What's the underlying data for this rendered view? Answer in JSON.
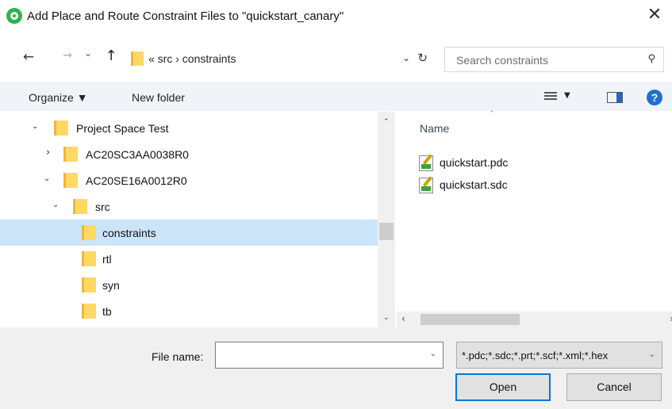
{
  "window": {
    "title": "Add Place and Route Constraint Files to \"quickstart_canary\"",
    "close_glyph": "✕"
  },
  "nav": {
    "back_glyph": "←",
    "forward_glyph": "→",
    "recent_glyph": "⌄",
    "up_glyph": "↑",
    "breadcrumb": "«  src  ›  constraints",
    "refresh_glyph": "↻",
    "address_dropdown_glyph": "⌄",
    "search_placeholder": "Search constraints",
    "search_glyph": "⚲"
  },
  "toolbar": {
    "organize_label": "Organize ▼",
    "new_folder_label": "New folder",
    "view_dropdown_glyph": "▼",
    "help_glyph": "?"
  },
  "tree": {
    "items": [
      {
        "label": "Project Space Test",
        "chevron": "⌄",
        "level": 0,
        "expanded": true,
        "selected": false
      },
      {
        "label": "AC20SC3AA0038R0",
        "chevron": "›",
        "level": 1,
        "expanded": false,
        "selected": false
      },
      {
        "label": "AC20SE16A0012R0",
        "chevron": "⌄",
        "level": 1,
        "expanded": true,
        "selected": false
      },
      {
        "label": "src",
        "chevron": "⌄",
        "level": 2,
        "expanded": true,
        "selected": false
      },
      {
        "label": "constraints",
        "chevron": "",
        "level": 3,
        "expanded": false,
        "selected": true
      },
      {
        "label": "rtl",
        "chevron": "",
        "level": 3,
        "expanded": false,
        "selected": false
      },
      {
        "label": "syn",
        "chevron": "",
        "level": 3,
        "expanded": false,
        "selected": false
      },
      {
        "label": "tb",
        "chevron": "",
        "level": 3,
        "expanded": false,
        "selected": false
      }
    ],
    "scroll_up_glyph": "⌃",
    "scroll_down_glyph": "⌄"
  },
  "files": {
    "column_name": "Name",
    "sort_glyph": "⌃",
    "items": [
      {
        "name": "quickstart.pdc",
        "icon": "constraint-file-icon"
      },
      {
        "name": "quickstart.sdc",
        "icon": "constraint-file-icon"
      }
    ],
    "scroll_left_glyph": "‹",
    "scroll_right_glyph": "›"
  },
  "bottom": {
    "file_name_label": "File name:",
    "file_name_value": "",
    "file_name_dropdown_glyph": "⌄",
    "file_type_value": "*.pdc;*.sdc;*.prt;*.scf;*.xml;*.hex",
    "file_type_dropdown_glyph": "⌄",
    "open_label": "Open",
    "cancel_label": "Cancel"
  },
  "colors": {
    "selection": "#cce4f7",
    "toolbar_bg": "#f0f4f9",
    "folder": "#ffd866",
    "accent": "#0078d7",
    "app_icon": "#2fb34a"
  }
}
